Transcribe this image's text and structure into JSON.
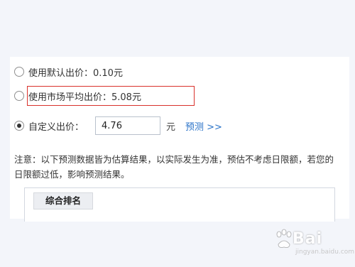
{
  "options": {
    "default_bid": {
      "label": "使用默认出价：0.10元",
      "checked": false
    },
    "market_avg_bid": {
      "label": "使用市场平均出价：5.08元",
      "checked": false
    },
    "custom_bid": {
      "label": "自定义出价：",
      "checked": true,
      "value": "4.76",
      "unit": "元"
    }
  },
  "predict_link": "预测 >>",
  "note": "注意：以下预测数据皆为估算结果，以实际发生为准，预估不考虑日限额，若您的日限额过低，影响预测结果。",
  "rank_tab": "综合排名",
  "colors": {
    "highlight_border": "#d9312b",
    "link": "#2b73c8",
    "page_background": "#f3f5fa"
  },
  "watermark": {
    "logo_text": "Bai",
    "sub_text": "jingyan.baidu.com"
  }
}
